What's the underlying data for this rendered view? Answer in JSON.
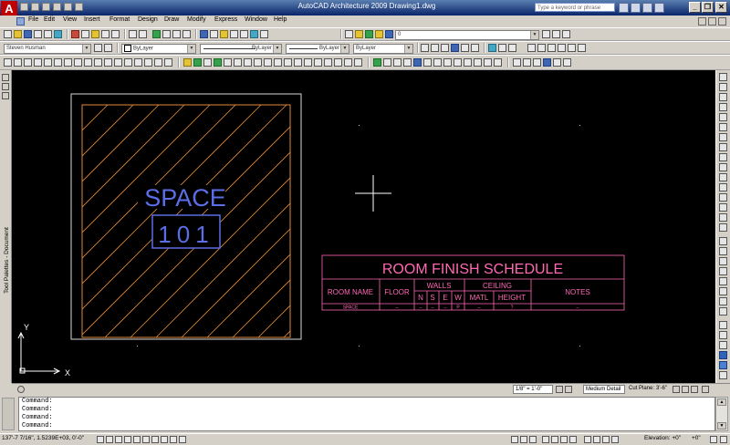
{
  "window": {
    "title": "AutoCAD Architecture 2009  Drawing1.dwg",
    "search_placeholder": "Type a keyword or phrase",
    "minimize": "_",
    "restore": "❐",
    "close": "✕"
  },
  "menu": {
    "items": [
      "File",
      "Edit",
      "View",
      "Insert",
      "Format",
      "Design",
      "Draw",
      "Modify",
      "Express",
      "Window",
      "Help"
    ]
  },
  "toolbar2": {
    "layer_combo": "Steven Husman",
    "color_combo": "ByLayer",
    "linetype_combo": "ByLayer",
    "lineweight_combo": "ByLayer",
    "plotstyle_combo": "ByLayer",
    "layer_state_value": "0"
  },
  "left_palette": {
    "label": "Tool Palettes - Document"
  },
  "drawing": {
    "space_label": "SPACE",
    "space_number": "101",
    "ucs_x": "X",
    "ucs_y": "Y",
    "schedule": {
      "title": "ROOM FINISH SCHEDULE",
      "headers": {
        "room_name": "ROOM NAME",
        "floor": "FLOOR",
        "walls": "WALLS",
        "ceiling": "CEILING",
        "notes": "NOTES",
        "n": "N",
        "s": "S",
        "e": "E",
        "w": "W",
        "matl": "MATL",
        "height": "HEIGHT"
      },
      "row": {
        "room_name": "SPACE",
        "floor": "--",
        "n": "--",
        "s": "--",
        "e": "--",
        "w": "P",
        "matl": "--",
        "height": "?",
        "notes": "--"
      }
    }
  },
  "canvas_status": {
    "scale": "1/8\" = 1'-0\"",
    "detail": "Medium Detail",
    "cut_plane_label": "Cut Plane:",
    "cut_plane_value": "3'-6\""
  },
  "command": {
    "lines": [
      "Command:",
      "Command:",
      "Command:",
      "Command:"
    ]
  },
  "status": {
    "coordinates": "137'-7 7/16\", 1.5239E+03, 0'-0\"",
    "elevation": "Elevation: +0\"",
    "elevation_extra": "+0\""
  },
  "colors": {
    "title_blue": "#0a246a",
    "canvas_bg": "#000000",
    "schedule_pink": "#ff69b4",
    "hatch_orange": "#e08a3a",
    "space_blue": "#5b6ee6"
  }
}
